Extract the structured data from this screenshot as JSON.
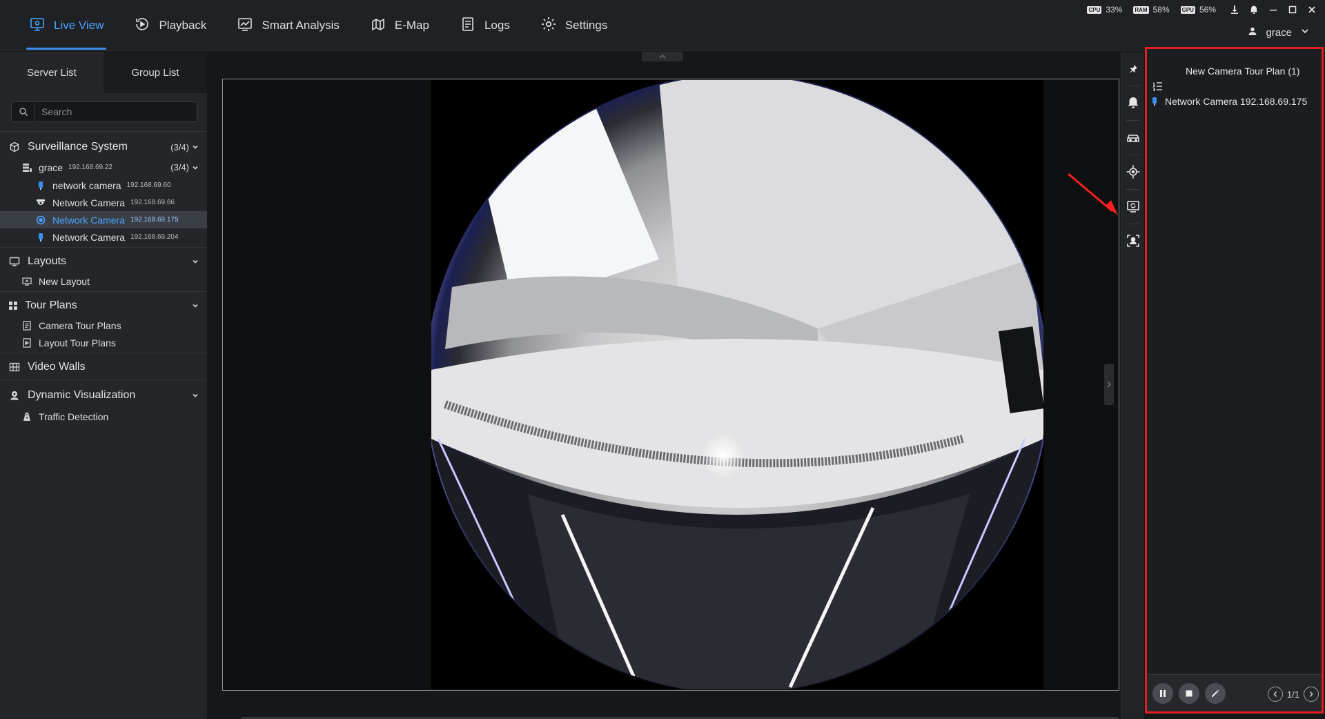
{
  "nav": {
    "items": [
      {
        "label": "Live View",
        "icon": "live-view-icon",
        "active": true
      },
      {
        "label": "Playback",
        "icon": "playback-icon"
      },
      {
        "label": "Smart Analysis",
        "icon": "smart-analysis-icon"
      },
      {
        "label": "E-Map",
        "icon": "e-map-icon"
      },
      {
        "label": "Logs",
        "icon": "logs-icon"
      },
      {
        "label": "Settings",
        "icon": "gear-icon"
      }
    ]
  },
  "system": {
    "cpu_chip": "CPU",
    "cpu": "33%",
    "ram_chip": "RAM",
    "ram": "58%",
    "gpu_chip": "GPU",
    "gpu": "56%"
  },
  "user": {
    "name": "grace"
  },
  "left_panel": {
    "tabs": [
      "Server List",
      "Group List"
    ],
    "active_tab": "Server List",
    "search_placeholder": "Search",
    "tree": {
      "surveillance": {
        "label": "Surveillance System",
        "count": "(3/4)"
      },
      "server": {
        "label": "grace",
        "ip": "192.168.69.22",
        "count": "(3/4)"
      },
      "cameras": [
        {
          "label": "network camera",
          "ip": "192.168.69.60",
          "icon": "bullet-camera-icon"
        },
        {
          "label": "Network Camera",
          "ip": "192.168.69.66",
          "icon": "dome-camera-icon"
        },
        {
          "label": "Network Camera",
          "ip": "192.168.69.175",
          "icon": "fisheye-camera-icon",
          "selected": true
        },
        {
          "label": "Network Camera",
          "ip": "192.168.69.204",
          "icon": "bullet-camera-icon"
        }
      ],
      "layouts": {
        "label": "Layouts",
        "items": [
          "New Layout"
        ]
      },
      "tour_plans": {
        "label": "Tour Plans",
        "items": [
          "Camera Tour Plans",
          "Layout Tour Plans"
        ]
      },
      "video_walls": {
        "label": "Video Walls"
      },
      "dynamic": {
        "label": "Dynamic Visualization",
        "items": [
          "Traffic Detection"
        ]
      }
    }
  },
  "right_tools": [
    "pin-icon",
    "bell-icon",
    "car-icon",
    "ptz-icon",
    "camera-tour-icon",
    "face-recognition-icon"
  ],
  "tour_panel": {
    "title": "New Camera Tour Plan  (1)",
    "items": [
      {
        "label": "Network Camera 192.168.69.175"
      }
    ],
    "page": "1/1"
  },
  "colors": {
    "accent": "#3a8ff0",
    "highlight_border": "#e02020",
    "background": "#161719"
  }
}
